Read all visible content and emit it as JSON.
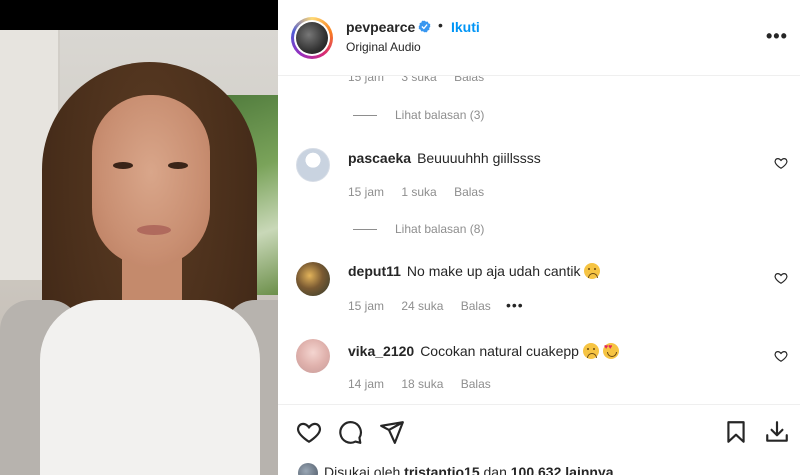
{
  "post": {
    "username": "pevpearce",
    "separator": "•",
    "follow_label": "Ikuti",
    "audio_label": "Original Audio",
    "more_label": "•••"
  },
  "comments": [
    {
      "partial": true,
      "time": "15 jam",
      "likes": "3 suka",
      "reply": "Balas",
      "view_replies": "Lihat balasan (3)"
    },
    {
      "user": "pascaeka",
      "text": "Beuuuuhhh giillssss",
      "time": "15 jam",
      "likes": "1 suka",
      "reply": "Balas",
      "view_replies": "Lihat balasan (8)"
    },
    {
      "user": "deput11",
      "text": "No make up aja udah cantik",
      "emoji": [
        "sad-face-emoji"
      ],
      "time": "15 jam",
      "likes": "24 suka",
      "reply": "Balas",
      "more": "•••"
    },
    {
      "user": "vika_2120",
      "text": "Cocokan natural cuakepp",
      "emoji": [
        "sad-face-emoji",
        "heart-eyes-emoji"
      ],
      "time": "14 jam",
      "likes": "18 suka",
      "reply": "Balas"
    }
  ],
  "likes_summary": {
    "prefix": "Disukai oleh",
    "user": "tristantio15",
    "middle": "dan",
    "count": "100.632 lainnya"
  },
  "icons": [
    "verified-icon",
    "heart-icon",
    "comment-icon",
    "share-icon",
    "save-icon",
    "download-icon",
    "more-icon"
  ],
  "colors": {
    "accent": "#0095f6",
    "verified": "#3897f0",
    "secondary_text": "#8e8e8e",
    "primary_text": "#262626"
  }
}
